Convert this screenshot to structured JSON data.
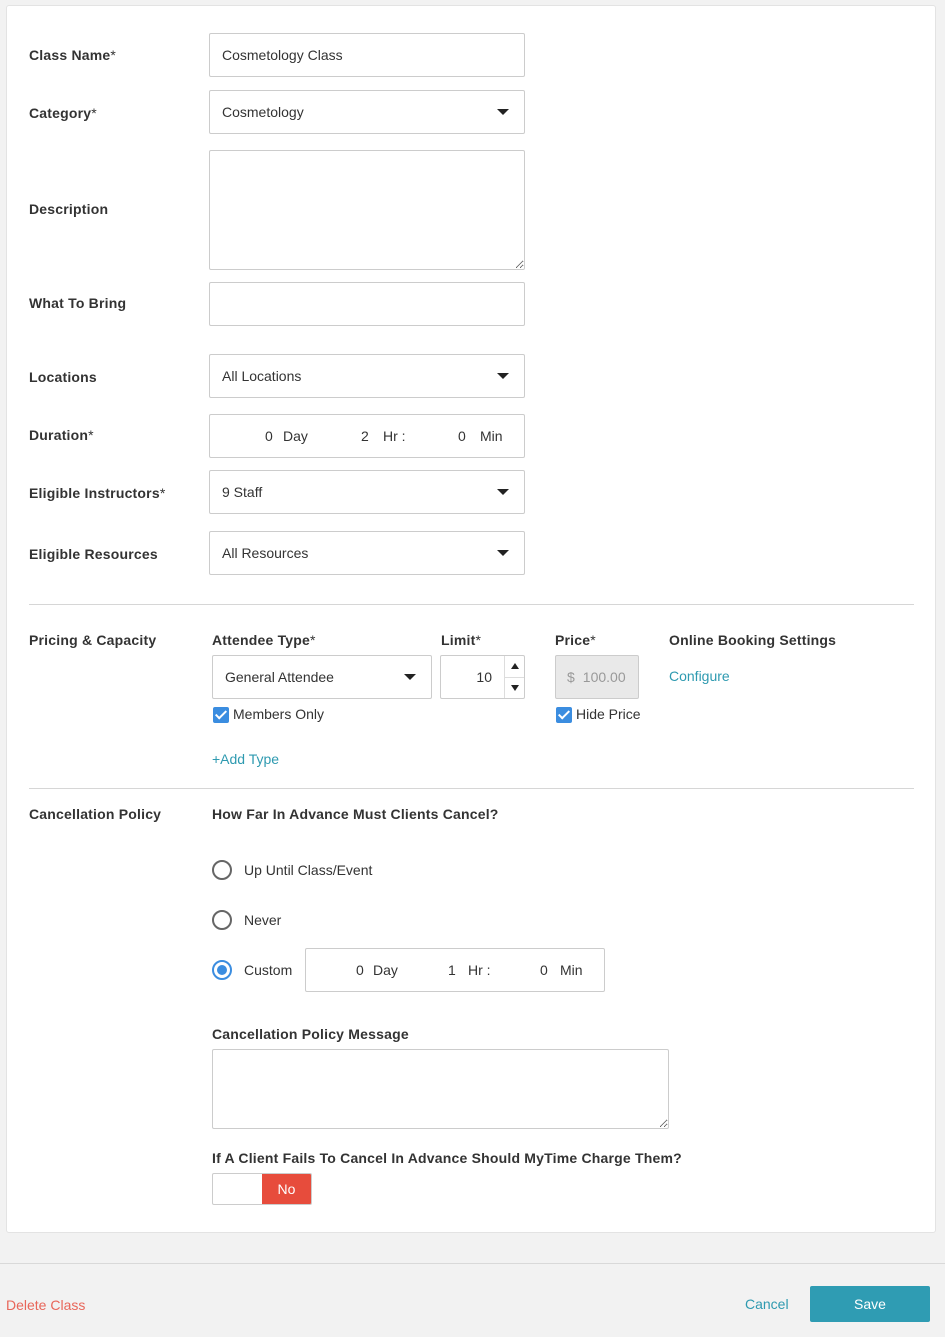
{
  "form": {
    "class_name": {
      "label": "Class Name",
      "required": "*",
      "value": "Cosmetology Class"
    },
    "category": {
      "label": "Category",
      "required": "*",
      "value": "Cosmetology"
    },
    "description": {
      "label": "Description",
      "value": ""
    },
    "what_to_bring": {
      "label": "What To Bring",
      "value": ""
    },
    "locations": {
      "label": "Locations",
      "value": "All Locations"
    },
    "duration": {
      "label": "Duration",
      "required": "*",
      "day": "0",
      "day_unit": "Day",
      "hr": "2",
      "hr_unit": "Hr :",
      "min": "0",
      "min_unit": "Min"
    },
    "eligible_instructors": {
      "label": "Eligible Instructors",
      "required": "*",
      "value": "9 Staff"
    },
    "eligible_resources": {
      "label": "Eligible Resources",
      "value": "All Resources"
    }
  },
  "pricing": {
    "section_label": "Pricing & Capacity",
    "attendee_type_header": "Attendee Type",
    "limit_header": "Limit",
    "price_header": "Price",
    "required": "*",
    "online_booking_header": "Online Booking Settings",
    "attendee_type_value": "General Attendee",
    "limit_value": "10",
    "currency": "$",
    "price_value": "100.00",
    "configure_link": "Configure",
    "members_only": "Members Only",
    "hide_price": "Hide Price",
    "add_type": "+Add Type"
  },
  "cancellation": {
    "section_label": "Cancellation Policy",
    "question": "How Far In Advance Must Clients Cancel?",
    "options": [
      "Up Until Class/Event",
      "Never",
      "Custom"
    ],
    "selected": "Custom",
    "custom": {
      "day": "0",
      "day_unit": "Day",
      "hr": "1",
      "hr_unit": "Hr :",
      "min": "0",
      "min_unit": "Min"
    },
    "message_label": "Cancellation Policy Message",
    "message_value": "",
    "charge_question": "If A Client Fails To Cancel In Advance Should MyTime Charge Them?",
    "charge_toggle": "No"
  },
  "footer": {
    "delete": "Delete Class",
    "cancel": "Cancel",
    "save": "Save"
  },
  "colors": {
    "accent": "#2f9cb3",
    "checkbox": "#3b8de0",
    "danger": "#e74c3c",
    "delete_text": "#e8665a"
  }
}
